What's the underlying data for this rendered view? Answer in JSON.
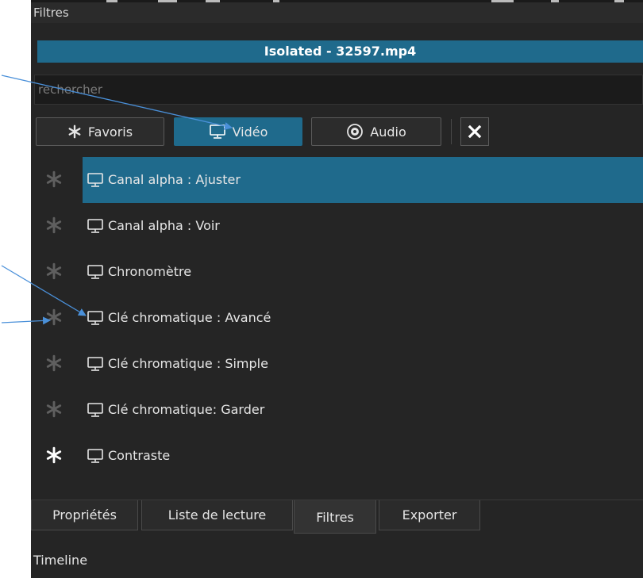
{
  "panel": {
    "title": "Filtres",
    "clip_name": "Isolated - 32597.mp4",
    "search_placeholder": "rechercher"
  },
  "toolbar": {
    "favorites_label": "Favoris",
    "video_label": "Vidéo",
    "audio_label": "Audio",
    "active": "video"
  },
  "filters": [
    {
      "label": "Canal alpha : Ajuster",
      "favorite": false,
      "selected": true
    },
    {
      "label": "Canal alpha : Voir",
      "favorite": false,
      "selected": false
    },
    {
      "label": "Chronomètre",
      "favorite": false,
      "selected": false
    },
    {
      "label": "Clé chromatique : Avancé",
      "favorite": false,
      "selected": false
    },
    {
      "label": "Clé chromatique : Simple",
      "favorite": false,
      "selected": false
    },
    {
      "label": "Clé chromatique: Garder",
      "favorite": false,
      "selected": false
    },
    {
      "label": "Contraste",
      "favorite": true,
      "selected": false
    }
  ],
  "tabs": [
    {
      "label": "Propriétés",
      "active": false
    },
    {
      "label": "Liste de lecture",
      "active": false
    },
    {
      "label": "Filtres",
      "active": true
    },
    {
      "label": "Exporter",
      "active": false
    }
  ],
  "bottom_panel": {
    "title": "Timeline"
  },
  "colors": {
    "accent": "#1f6a8c",
    "background": "#252525",
    "annotation_arrow": "#4a90d9"
  },
  "icons": {
    "favorite": "asterisk-icon",
    "video": "monitor-icon",
    "audio": "disc-icon",
    "clear": "close-icon"
  }
}
